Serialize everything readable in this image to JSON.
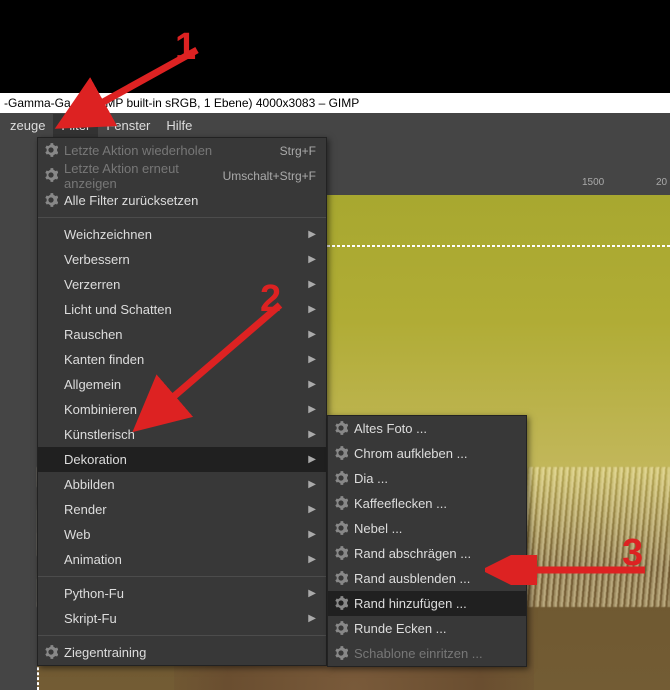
{
  "title": "-Gamma-Ga…   , GIMP built-in sRGB, 1 Ebene) 4000x3083 – GIMP",
  "menubar": {
    "items": [
      "zeuge",
      "Filter",
      "Fenster",
      "Hilfe"
    ],
    "open_index": 1
  },
  "ruler": {
    "ticks": [
      "1500",
      "20"
    ]
  },
  "filter_menu": {
    "top": [
      {
        "label": "Letzte Aktion wiederholen",
        "accel": "Strg+F",
        "gear": true,
        "disabled": true
      },
      {
        "label": "Letzte Aktion erneut anzeigen",
        "accel": "Umschalt+Strg+F",
        "gear": true,
        "disabled": true
      },
      {
        "label": "Alle Filter zurücksetzen",
        "gear": true,
        "disabled": false
      }
    ],
    "cats": [
      "Weichzeichnen",
      "Verbessern",
      "Verzerren",
      "Licht und Schatten",
      "Rauschen",
      "Kanten finden",
      "Allgemein",
      "Kombinieren",
      "Künstlerisch",
      "Dekoration",
      "Abbilden",
      "Render",
      "Web",
      "Animation"
    ],
    "hover_cat_index": 9,
    "scripting": [
      "Python-Fu",
      "Skript-Fu"
    ],
    "extra": {
      "label": "Ziegentraining",
      "gear": true
    }
  },
  "dekoration_submenu": {
    "items": [
      "Altes Foto ...",
      "Chrom aufkleben ...",
      "Dia ...",
      "Kaffeeflecken ...",
      "Nebel ...",
      "Rand abschrägen ...",
      "Rand ausblenden ...",
      "Rand hinzufügen ...",
      "Runde Ecken ...",
      "Schablone einritzen ..."
    ],
    "hover_index": 7,
    "disabled_index": 9
  },
  "annotations": {
    "n1": "1",
    "n2": "2",
    "n3": "3"
  }
}
